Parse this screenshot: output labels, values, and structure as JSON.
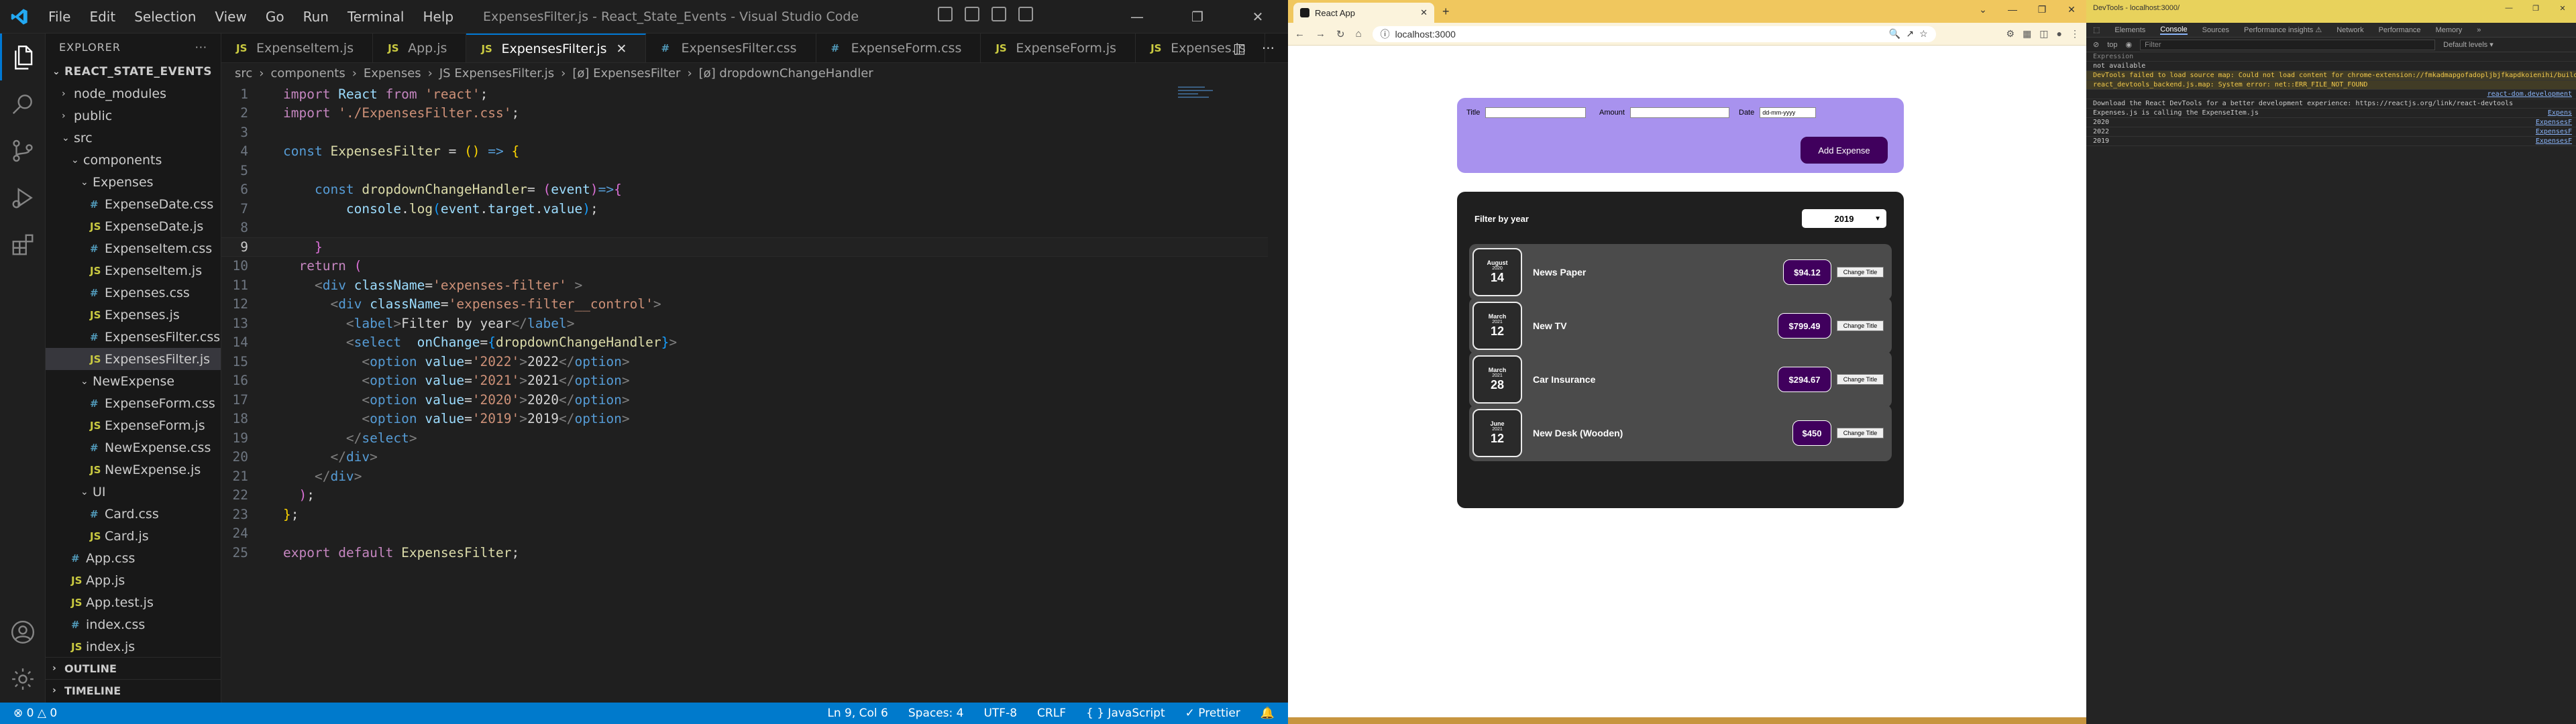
{
  "vscode": {
    "window_title": "ExpensesFilter.js - React_State_Events - Visual Studio Code",
    "menu": [
      "File",
      "Edit",
      "Selection",
      "View",
      "Go",
      "Run",
      "Terminal",
      "Help"
    ],
    "explorer": {
      "header": "EXPLORER",
      "project": "REACT_STATE_EVENTS",
      "items": [
        {
          "label": "node_modules",
          "type": "folder",
          "depth": 1,
          "open": false
        },
        {
          "label": "public",
          "type": "folder",
          "depth": 1,
          "open": false
        },
        {
          "label": "src",
          "type": "folder",
          "depth": 1,
          "open": true
        },
        {
          "label": "components",
          "type": "folder",
          "depth": 2,
          "open": true
        },
        {
          "label": "Expenses",
          "type": "folder",
          "depth": 3,
          "open": true
        },
        {
          "label": "ExpenseDate.css",
          "type": "css",
          "depth": 4
        },
        {
          "label": "ExpenseDate.js",
          "type": "js",
          "depth": 4
        },
        {
          "label": "ExpenseItem.css",
          "type": "css",
          "depth": 4
        },
        {
          "label": "ExpenseItem.js",
          "type": "js",
          "depth": 4
        },
        {
          "label": "Expenses.css",
          "type": "css",
          "depth": 4
        },
        {
          "label": "Expenses.js",
          "type": "js",
          "depth": 4
        },
        {
          "label": "ExpensesFilter.css",
          "type": "css",
          "depth": 4
        },
        {
          "label": "ExpensesFilter.js",
          "type": "js",
          "depth": 4,
          "selected": true
        },
        {
          "label": "NewExpense",
          "type": "folder",
          "depth": 3,
          "open": true
        },
        {
          "label": "ExpenseForm.css",
          "type": "css",
          "depth": 4
        },
        {
          "label": "ExpenseForm.js",
          "type": "js",
          "depth": 4
        },
        {
          "label": "NewExpense.css",
          "type": "css",
          "depth": 4
        },
        {
          "label": "NewExpense.js",
          "type": "js",
          "depth": 4
        },
        {
          "label": "UI",
          "type": "folder",
          "depth": 3,
          "open": true
        },
        {
          "label": "Card.css",
          "type": "css",
          "depth": 4
        },
        {
          "label": "Card.js",
          "type": "js",
          "depth": 4
        },
        {
          "label": "App.css",
          "type": "css",
          "depth": 2
        },
        {
          "label": "App.js",
          "type": "js",
          "depth": 2
        },
        {
          "label": "App.test.js",
          "type": "js",
          "depth": 2
        },
        {
          "label": "index.css",
          "type": "css",
          "depth": 2
        },
        {
          "label": "index.js",
          "type": "js",
          "depth": 2
        }
      ],
      "outline": "OUTLINE",
      "timeline": "TIMELINE"
    },
    "tabs": [
      {
        "label": "ExpenseItem.js",
        "type": "js"
      },
      {
        "label": "App.js",
        "type": "js"
      },
      {
        "label": "ExpensesFilter.js",
        "type": "js",
        "active": true
      },
      {
        "label": "ExpensesFilter.css",
        "type": "css"
      },
      {
        "label": "ExpenseForm.css",
        "type": "css"
      },
      {
        "label": "ExpenseForm.js",
        "type": "js"
      },
      {
        "label": "Expenses.js",
        "type": "js"
      }
    ],
    "breadcrumbs": [
      "src",
      "components",
      "Expenses",
      "JS ExpensesFilter.js",
      "[ø] ExpensesFilter",
      "[ø] dropdownChangeHandler"
    ],
    "current_line": 9,
    "status": {
      "errors": "⊗ 0 △ 0",
      "position": "Ln 9, Col 6",
      "spaces": "Spaces: 4",
      "encoding": "UTF-8",
      "eol": "CRLF",
      "language": "{ } JavaScript",
      "prettier": "✓ Prettier"
    }
  },
  "browser": {
    "tab_title": "React App",
    "url": "localhost:3000",
    "form": {
      "title_label": "Title",
      "amount_label": "Amount",
      "date_label": "Date",
      "date_placeholder": "dd-mm-yyyy",
      "add_button": "Add Expense"
    },
    "filter": {
      "label": "Filter by year",
      "selected": "2019",
      "options": [
        "2022",
        "2021",
        "2020",
        "2019"
      ]
    },
    "expenses": [
      {
        "month": "August",
        "year": "2020",
        "day": "14",
        "title": "News Paper",
        "amount": "$94.12"
      },
      {
        "month": "March",
        "year": "2021",
        "day": "12",
        "title": "New TV",
        "amount": "$799.49"
      },
      {
        "month": "March",
        "year": "2021",
        "day": "28",
        "title": "Car Insurance",
        "amount": "$294.67"
      },
      {
        "month": "June",
        "year": "2021",
        "day": "12",
        "title": "New Desk (Wooden)",
        "amount": "$450"
      }
    ],
    "change_title_label": "Change Title"
  },
  "devtools": {
    "title": "DevTools - localhost:3000/",
    "tabs": [
      "Elements",
      "Console",
      "Sources",
      "Performance insights ⚠",
      "Network",
      "Performance",
      "Memory",
      "»"
    ],
    "active_tab": "Console",
    "context": "top",
    "filter_placeholder": "Filter",
    "levels": "Default levels ▾",
    "console": [
      {
        "text": "Expression",
        "kind": "gray"
      },
      {
        "text": "not available",
        "kind": "normal"
      },
      {
        "text": "DevTools failed to load source map: Could not load content for chrome-extension://fmkadmapgofadopljbjfkapdkoienihi/build/",
        "kind": "warn"
      },
      {
        "text": "react_devtools_backend.js.map: System error: net::ERR_FILE_NOT_FOUND",
        "kind": "warn"
      },
      {
        "text": "",
        "kind": "normal",
        "src": "react-dom.development"
      },
      {
        "text": "Download the React DevTools for a better development experience: https://reactjs.org/link/react-devtools",
        "kind": "normal"
      },
      {
        "text": "Expenses.js is calling the ExpenseItem.js",
        "kind": "normal",
        "src": "Expens"
      },
      {
        "text": "2020",
        "kind": "normal",
        "src": "ExpensesF"
      },
      {
        "text": "2022",
        "kind": "normal",
        "src": "ExpensesF"
      },
      {
        "text": "2019",
        "kind": "normal",
        "src": "ExpensesF"
      }
    ]
  }
}
